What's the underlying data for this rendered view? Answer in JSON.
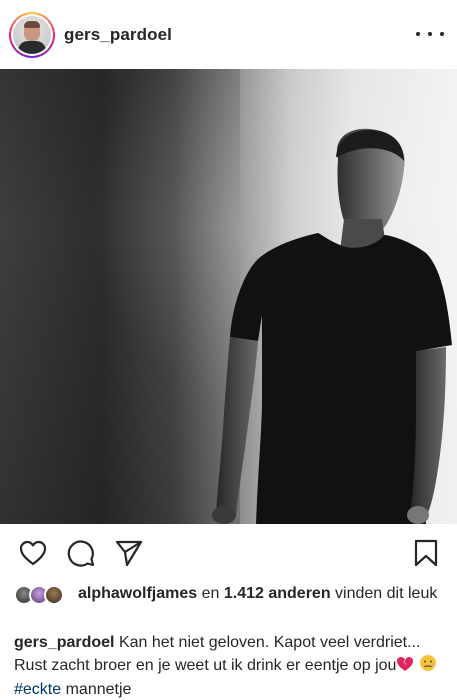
{
  "header": {
    "username": "gers_pardoel",
    "avatar_icon": "profile-photo",
    "more_icon": "more-horizontal-icon"
  },
  "post_image": {
    "description_icon": "black-and-white-portrait-photo"
  },
  "actions": {
    "like_icon": "heart-icon",
    "comment_icon": "comment-icon",
    "share_icon": "send-icon",
    "save_icon": "bookmark-icon"
  },
  "likes": {
    "first_liker": "alphawolfjames",
    "connector": "en",
    "others": "1.412 anderen",
    "suffix": "vinden dit leuk"
  },
  "caption": {
    "username": "gers_pardoel",
    "text": "Kan het niet geloven. Kapot veel verdriet... Rust zacht broer en je weet ut ik drink er eentje op jou",
    "hashtag": "#eckte",
    "trailing": "mannetje"
  },
  "colors": {
    "text": "#262626",
    "hashtag": "#003569",
    "broken_heart": "#e0245e",
    "sad_face": "#f7c23c"
  }
}
